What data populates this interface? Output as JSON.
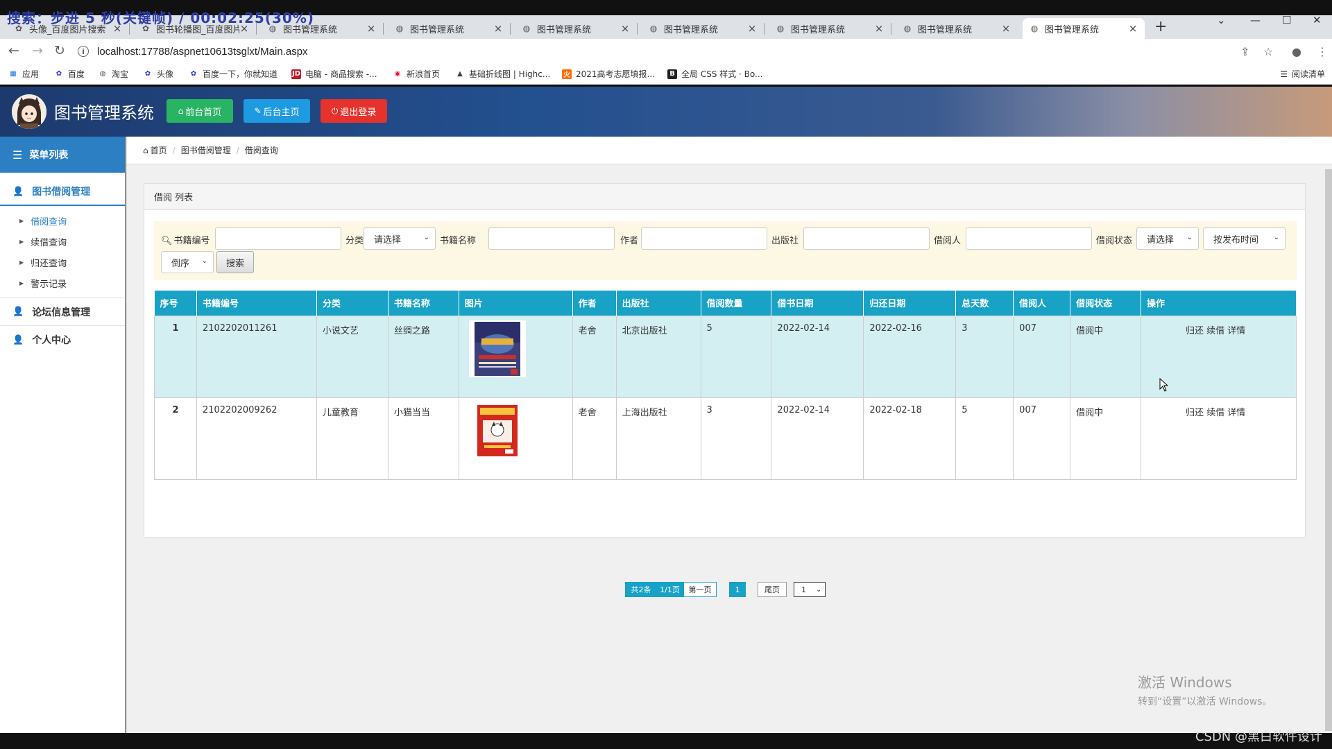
{
  "overlay": "搜索：步进 5 秒(关键帧) / 00:02:25(30%)",
  "browser": {
    "tabs": [
      {
        "title": "头像_百度图片搜索",
        "icon": "paw-icon"
      },
      {
        "title": "图书轮播图_百度图片",
        "icon": "paw-icon"
      },
      {
        "title": "图书管理系统",
        "icon": "globe-icon"
      },
      {
        "title": "图书管理系统",
        "icon": "globe-icon"
      },
      {
        "title": "图书管理系统",
        "icon": "globe-icon"
      },
      {
        "title": "图书管理系统",
        "icon": "globe-icon"
      },
      {
        "title": "图书管理系统",
        "icon": "globe-icon"
      },
      {
        "title": "图书管理系统",
        "icon": "globe-icon"
      },
      {
        "title": "图书管理系统",
        "icon": "globe-icon",
        "active": true
      }
    ],
    "url": "localhost:17788/aspnet10613tsglxt/Main.aspx",
    "bookmarks": [
      {
        "label": "应用",
        "color": "#1a73e8"
      },
      {
        "label": "百度",
        "color": "#2932e1"
      },
      {
        "label": "淘宝",
        "color": "#555555"
      },
      {
        "label": "头像",
        "color": "#2932e1"
      },
      {
        "label": "百度一下，你就知道",
        "color": "#2932e1"
      },
      {
        "label": "电脑 - 商品搜索 -...",
        "color": "#c91623"
      },
      {
        "label": "新浪首页",
        "color": "#e6162d"
      },
      {
        "label": "基础折线图 | Highc...",
        "color": "#434348"
      },
      {
        "label": "2021高考志愿填报...",
        "color": "#ff6a00"
      },
      {
        "label": "全局 CSS 样式 · Bo...",
        "color": "#563d7c"
      }
    ],
    "reading_list": "阅读清单"
  },
  "header": {
    "title": "图书管理系统",
    "buttons": {
      "front": "前台首页",
      "back": "后台主页",
      "logout": "退出登录"
    },
    "colors": {
      "front": "#28b463",
      "back": "#1e9be0",
      "logout": "#e5322d"
    }
  },
  "sidebar": {
    "head": "菜单列表",
    "groups": [
      {
        "label": "图书借阅管理",
        "subs": [
          "借阅查询",
          "续借查询",
          "归还查询",
          "警示记录"
        ]
      },
      {
        "label": "论坛信息管理"
      },
      {
        "label": "个人中心"
      }
    ]
  },
  "breadcrumb": [
    "首页",
    "图书借阅管理",
    "借阅查询"
  ],
  "panel_title": "借阅 列表",
  "filters": {
    "book_no": "书籍编号",
    "category": "分类",
    "category_select": "请选择",
    "book_name": "书籍名称",
    "author": "作者",
    "publisher": "出版社",
    "borrower": "借阅人",
    "status": "借阅状态",
    "status_select": "请选择",
    "sort": "按发布时间",
    "order": "倒序",
    "search": "搜索"
  },
  "table": {
    "headers": [
      "序号",
      "书籍编号",
      "分类",
      "书籍名称",
      "图片",
      "作者",
      "出版社",
      "借阅数量",
      "借书日期",
      "归还日期",
      "总天数",
      "借阅人",
      "借阅状态",
      "操作"
    ],
    "rows": [
      {
        "idx": "1",
        "no": "2102202011261",
        "cat": "小说文艺",
        "name": "丝绸之路",
        "author": "老舍",
        "pub": "北京出版社",
        "qty": "5",
        "borrow": "2022-02-14",
        "return": "2022-02-16",
        "days": "3",
        "user": "007",
        "status": "借阅中"
      },
      {
        "idx": "2",
        "no": "2102202009262",
        "cat": "儿童教育",
        "name": "小猫当当",
        "author": "老舍",
        "pub": "上海出版社",
        "qty": "3",
        "borrow": "2022-02-14",
        "return": "2022-02-18",
        "days": "5",
        "user": "007",
        "status": "借阅中"
      }
    ],
    "ops": [
      "归还",
      "续借",
      "详情"
    ]
  },
  "pager": {
    "total": "共2条",
    "pages": "1/1页",
    "first": "第一页",
    "current": "1",
    "last": "尾页",
    "select": "1"
  },
  "windows_activation": {
    "line1": "激活 Windows",
    "line2": "转到“设置”以激活 Windows。"
  },
  "watermark": "CSDN @黑白软件设计"
}
